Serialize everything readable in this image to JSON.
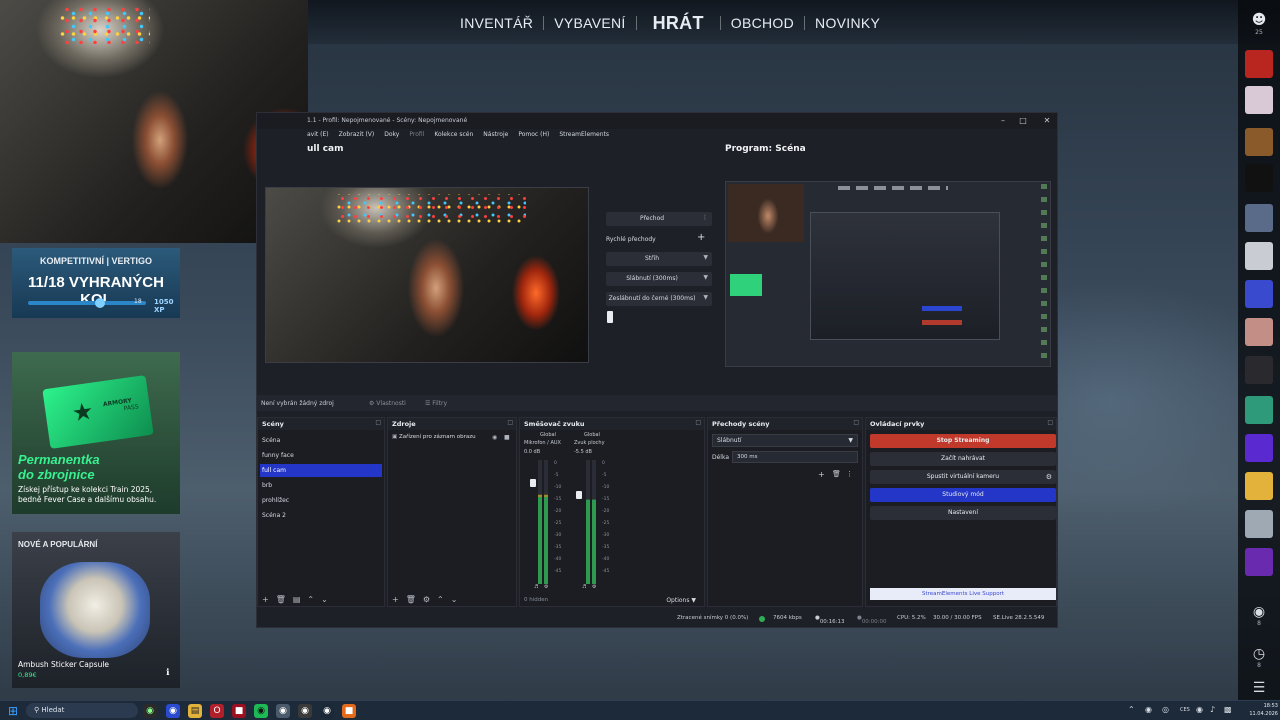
{
  "game_nav": {
    "items": [
      "INVENTÁŘ",
      "VYBAVENÍ",
      "HRÁT",
      "OBCHOD",
      "NOVINKY"
    ],
    "active": "HRÁT"
  },
  "friends": {
    "count": "25"
  },
  "panels": {
    "competitive": {
      "label": "KOMPETITIVNÍ | VERTIGO",
      "title": "11/18 VYHRANÝCH KOL",
      "level": "18",
      "xp": "1050 XP",
      "progress": 0.61
    },
    "armory": {
      "pass_label": "ARMORY",
      "pass_sub": "PASS",
      "title_line1": "Permanentka",
      "title_line2": "do zbrojnice",
      "description": "Získej přístup ke kolekci Train 2025, bedně Fever Case a dalšímu obsahu."
    },
    "new_popular": {
      "label": "NOVÉ A POPULÁRNÍ",
      "item_name": "Ambush Sticker Capsule",
      "price": "0,89€"
    }
  },
  "obs": {
    "title": "1.1 - Profil: Nepojmenované - Scény: Nepojmenované",
    "menu": [
      "avit (E)",
      "Zobrazit (V)",
      "Doky",
      "Profil",
      "Kolekce scén",
      "Nástroje",
      "Pomoc (H)",
      "StreamElements"
    ],
    "preview_title": "ull cam",
    "program_title": "Program: Scéna",
    "transitions": {
      "transition_button": "Přechod",
      "quick_label": "Rychlé přechody",
      "items": [
        "Střih",
        "Slábnutí (300ms)",
        "Zeslábnutí do černé (300ms)"
      ]
    },
    "info_bar": {
      "no_source": "Není vybrán žádný zdroj",
      "properties": "Vlastnosti",
      "filters": "Filtry"
    },
    "docks": {
      "scenes": {
        "title": "Scény",
        "items": [
          "Scéna",
          "funny face",
          "full cam",
          "brb",
          "prohlížec",
          "Scéna 2"
        ],
        "selected": "full cam"
      },
      "sources": {
        "title": "Zdroje",
        "items": [
          "Zařízení pro záznam obrazu"
        ]
      },
      "mixer": {
        "title": "Směšovač zvuku",
        "channels": [
          {
            "name": "Mikrofon / AUX",
            "tag": "Global",
            "db": "0.0 dB",
            "level": 0.72,
            "fader": 0.85
          },
          {
            "name": "Zvuk plochy",
            "tag": "Global",
            "db": "-5.5 dB",
            "level": 0.68,
            "fader": 0.75
          }
        ],
        "scale": [
          "0",
          "-5",
          "-10",
          "-15",
          "-20",
          "-25",
          "-30",
          "-35",
          "-40",
          "-45",
          "-50"
        ],
        "hidden": "0 hidden",
        "options": "Options"
      },
      "transitions": {
        "title": "Přechody scény",
        "selected": "Slábnutí",
        "duration_label": "Délka",
        "duration": "300 ms"
      },
      "controls": {
        "title": "Ovládací prvky",
        "stop_streaming": "Stop Streaming",
        "start_recording": "Začít nahrávat",
        "virtual_camera": "Spustit virtuální kameru",
        "studio_mode": "Studiový mód",
        "settings": "Nastavení",
        "se_support": "StreamElements Live Support"
      }
    },
    "status": {
      "dropped": "Ztracené snímky 0 (0.0%)",
      "bitrate": "7604 kbps",
      "stream_time": "00:16:13",
      "rec_time": "00:00:00",
      "cpu": "CPU: 5.2%",
      "fps": "30.00 / 30.00 FPS",
      "version": "SE.Live 28.2.5.549"
    }
  },
  "taskbar": {
    "search_placeholder": "Hledat",
    "lang": "CES",
    "time": "18:53",
    "date": "11.04.2026"
  },
  "colors": {
    "stop_red": "#c0392b",
    "studio_blue": "#2336c8",
    "selected_blue": "#2336c8",
    "armory_green": "#38f08f"
  }
}
